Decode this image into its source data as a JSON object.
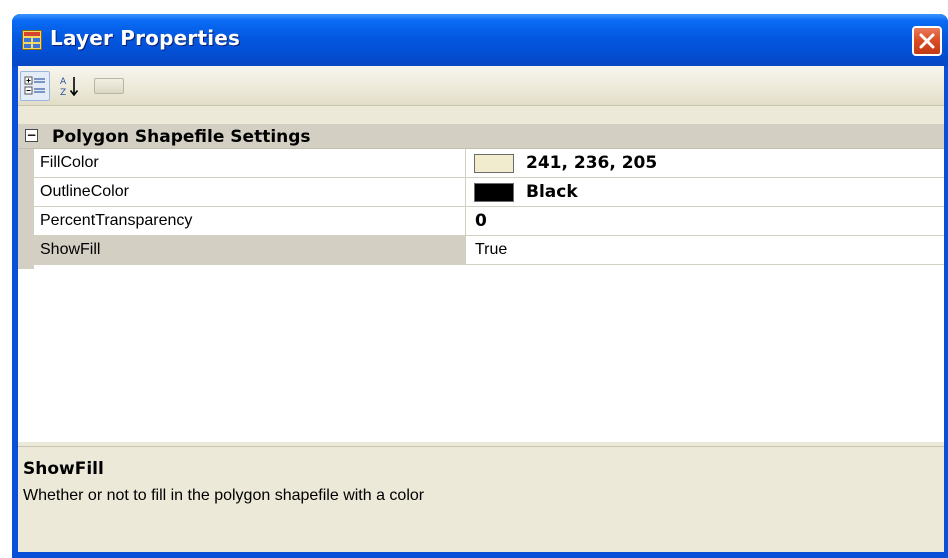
{
  "window": {
    "title": "Layer Properties",
    "icons": {
      "app": "property-grid-app-icon",
      "close": "close-icon"
    }
  },
  "toolbar": {
    "buttons": [
      {
        "name": "categorized-view-icon",
        "pressed": true
      },
      {
        "name": "alphabetical-sort-icon",
        "pressed": false
      },
      {
        "name": "property-pages-icon",
        "pressed": false
      }
    ]
  },
  "grid": {
    "category": {
      "label": "Polygon Shapefile Settings",
      "expanded": true,
      "toggle_glyph": "⊟"
    },
    "properties": [
      {
        "name": "FillColor",
        "value": "241, 236, 205",
        "swatch_color": "#f1eccd",
        "value_bold": true,
        "has_swatch": true
      },
      {
        "name": "OutlineColor",
        "value": "Black",
        "swatch_color": "#000000",
        "value_bold": true,
        "has_swatch": true
      },
      {
        "name": "PercentTransparency",
        "value": "0",
        "value_bold": true,
        "has_swatch": false
      },
      {
        "name": "ShowFill",
        "value": "True",
        "value_bold": false,
        "has_swatch": false,
        "selected": true
      }
    ]
  },
  "help": {
    "title": "ShowFill",
    "description": "Whether or not to fill in the polygon shapefile with a color"
  },
  "colors": {
    "titlebar": "#0458e0",
    "window_bg": "#ece9d8",
    "category_bg": "#d3d0c3",
    "close_button": "#d94b23"
  }
}
